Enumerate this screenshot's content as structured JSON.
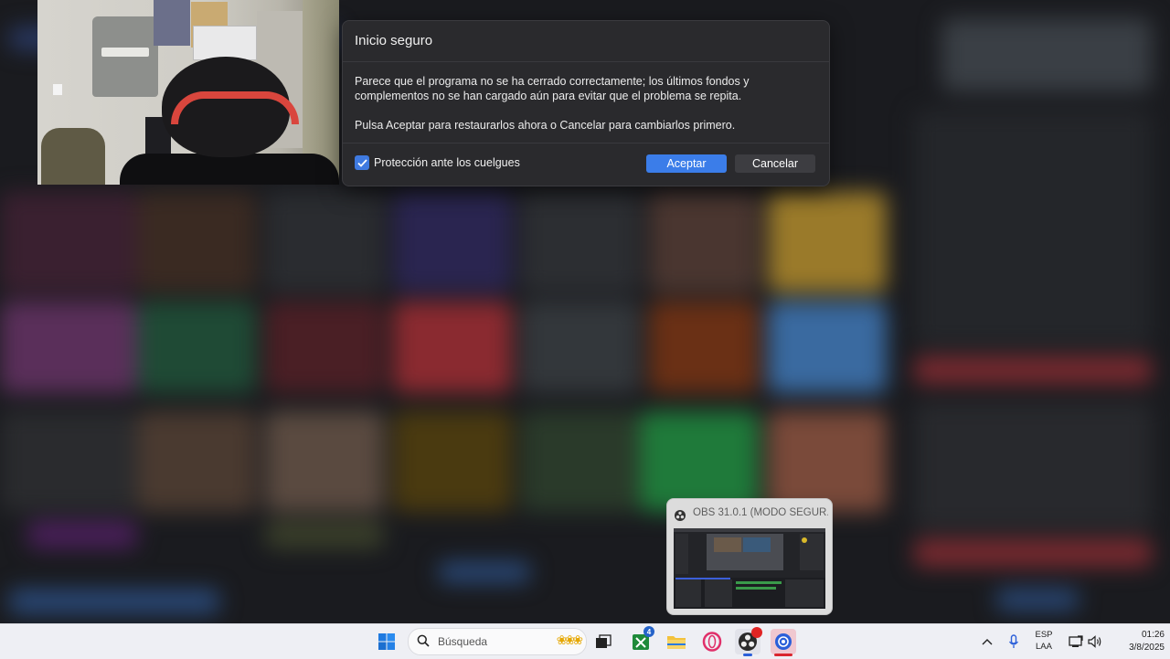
{
  "dialog": {
    "title": "Inicio seguro",
    "message_line1": "Parece que el programa no se ha cerrado correctamente; los últimos fondos y complementos no se han cargado aún para evitar que el problema se repita.",
    "message_line2": "Pulsa Aceptar para restaurarlos ahora o Cancelar para cambiarlos primero.",
    "checkbox_label": "Protección ante los cuelgues",
    "checkbox_checked": true,
    "accept_label": "Aceptar",
    "cancel_label": "Cancelar",
    "accent_color": "#3b7de9"
  },
  "preview": {
    "title": "OBS 31.0.1 (MODO SEGUR...",
    "icon": "obs-icon"
  },
  "taskbar": {
    "search_placeholder": "Búsqueda",
    "icons": [
      "windows-start-icon",
      "search-icon",
      "task-view-icon",
      "xbox-icon",
      "file-explorer-icon",
      "opera-gx-icon",
      "obs-icon",
      "screen-capture-icon"
    ],
    "xbox_badge": "4",
    "language": {
      "line1": "ESP",
      "line2": "LAA"
    },
    "clock": {
      "time": "01:26",
      "date": "3/8/2025"
    }
  }
}
